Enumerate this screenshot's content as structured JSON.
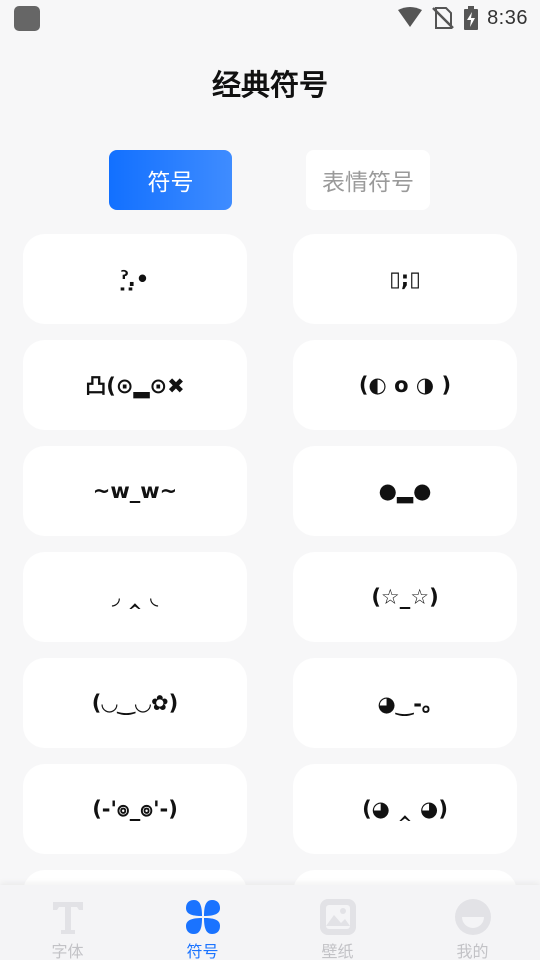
{
  "status": {
    "time": "8:36"
  },
  "header": {
    "title": "经典符号"
  },
  "tabs": [
    {
      "label": "符号"
    },
    {
      "label": "表情符号"
    }
  ],
  "symbols": [
    "ˀ̣.̣•",
    "▯;▯",
    "凸(⊙▂⊙✖",
    "(◐ o ◑ )",
    "~w_w~",
    "●▂●",
    "◞ ‸ ◟",
    "(☆_☆)",
    "(◡‿◡✿)",
    "◕‿-｡",
    "(-'๏_๏'-)",
    "(◕ ‸ ◕)"
  ],
  "nav": [
    {
      "label": "字体"
    },
    {
      "label": "符号"
    },
    {
      "label": "壁纸"
    },
    {
      "label": "我的"
    }
  ],
  "colors": {
    "accent": "#1a73ff",
    "inactive": "#c2c2c6",
    "background": "#f7f7f8"
  },
  "icons": [
    "signal-icon",
    "no-sim-icon",
    "battery-icon",
    "font-icon",
    "symbols-icon",
    "wallpaper-icon",
    "profile-icon"
  ]
}
